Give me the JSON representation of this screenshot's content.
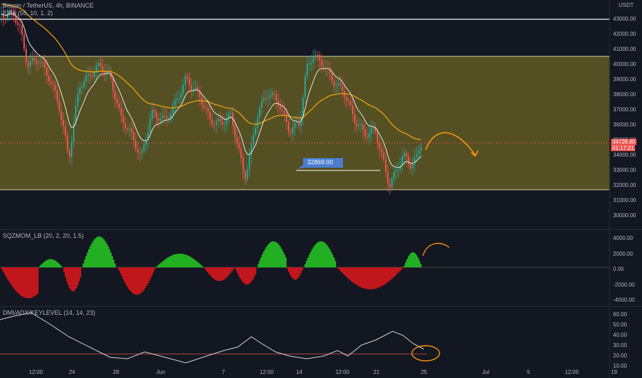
{
  "header": {
    "symbol_title": "Bitcoin / TetherUS, 4h, BINANCE",
    "ema_label": "EMA (55, 10, 1, 2)",
    "currency": "USDT"
  },
  "price_axis": {
    "ticks": [
      "43000.00",
      "42000.00",
      "41000.00",
      "40000.00",
      "39000.00",
      "38000.00",
      "37000.00",
      "36000.00",
      "35000.00",
      "34000.00",
      "33000.00",
      "32000.00",
      "31000.00",
      "30000.00"
    ],
    "current_price": "34728.85",
    "countdown": "01:17:21"
  },
  "annotation": {
    "level_label": "32869.00"
  },
  "momentum_panel": {
    "title": "SQZMOM_LB (20, 2, 20, 1.5)",
    "ticks": [
      "4000.00",
      "2000.00",
      "0.00",
      "-2000.00",
      "-4000.00"
    ]
  },
  "dmi_panel": {
    "title": "DMI/ADX/KEYLEVEL (14, 14, 23)",
    "ticks": [
      "60.00",
      "50.00",
      "40.00",
      "30.00",
      "20.00",
      "10.00"
    ]
  },
  "time_axis": {
    "ticks": [
      "12:00",
      "24",
      "28",
      "Jun",
      "7",
      "12:00",
      "14",
      "12:00",
      "21",
      "25",
      "Jul",
      "5",
      "12:00",
      "19"
    ]
  },
  "colors": {
    "background": "#131722",
    "zone": "#6b6424",
    "ema55": "#f0a30a",
    "ema10": "#e8e8e8",
    "candle_up": "#26a69a",
    "candle_down": "#ef5350",
    "hist_up": "#22b022",
    "hist_down": "#c0171c",
    "annotation_orange": "#ff9800",
    "label_blue": "#4a7dd0"
  }
}
